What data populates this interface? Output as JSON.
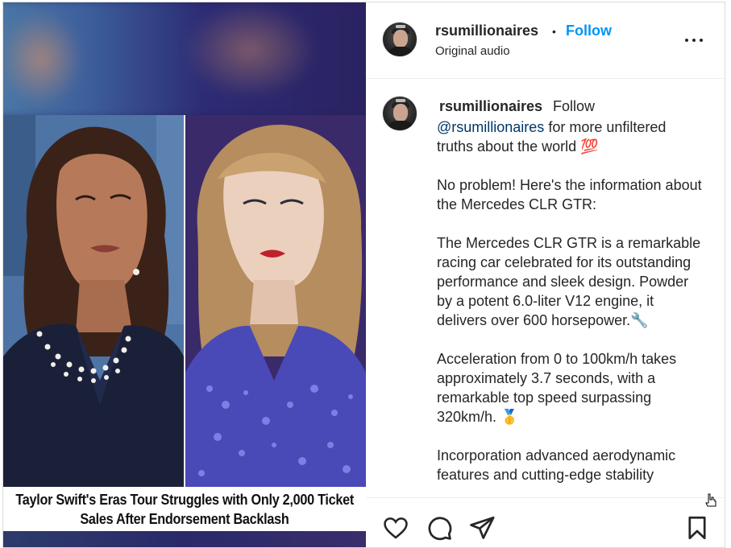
{
  "post": {
    "image": {
      "caption_line1": "Taylor Swift's Eras Tour Struggles with Only 2,000 Ticket",
      "caption_line2": "Sales After Endorsement Backlash"
    }
  },
  "header": {
    "username": "rsumillionaires",
    "separator": "•",
    "follow_label": "Follow",
    "audio_label": "Original audio",
    "more_icon": "more-horizontal-icon"
  },
  "caption": {
    "username": "rsumillionaires",
    "follow_text": "Follow",
    "mention": "@rsumillionaires",
    "intro_rest": " for more unfiltered truths about the world 💯",
    "para1": "No problem! Here's the information about the Mercedes CLR GTR:",
    "para2": "The Mercedes CLR GTR is a remarkable racing car celebrated for its outstanding performance and sleek design. Powder by a potent 6.0-liter V12 engine, it delivers over 600 horsepower.🔧",
    "para3": "Acceleration from 0 to 100km/h takes approximately 3.7 seconds, with a remarkable top speed surpassing 320km/h. 🥇",
    "para4": "Incorporation advanced aerodynamic features and cutting-edge stability"
  },
  "actions": {
    "like_icon": "heart-icon",
    "comment_icon": "comment-icon",
    "share_icon": "send-icon",
    "save_icon": "bookmark-icon"
  },
  "colors": {
    "follow_blue": "#0095f6",
    "mention": "#00376b",
    "text": "#262626"
  }
}
